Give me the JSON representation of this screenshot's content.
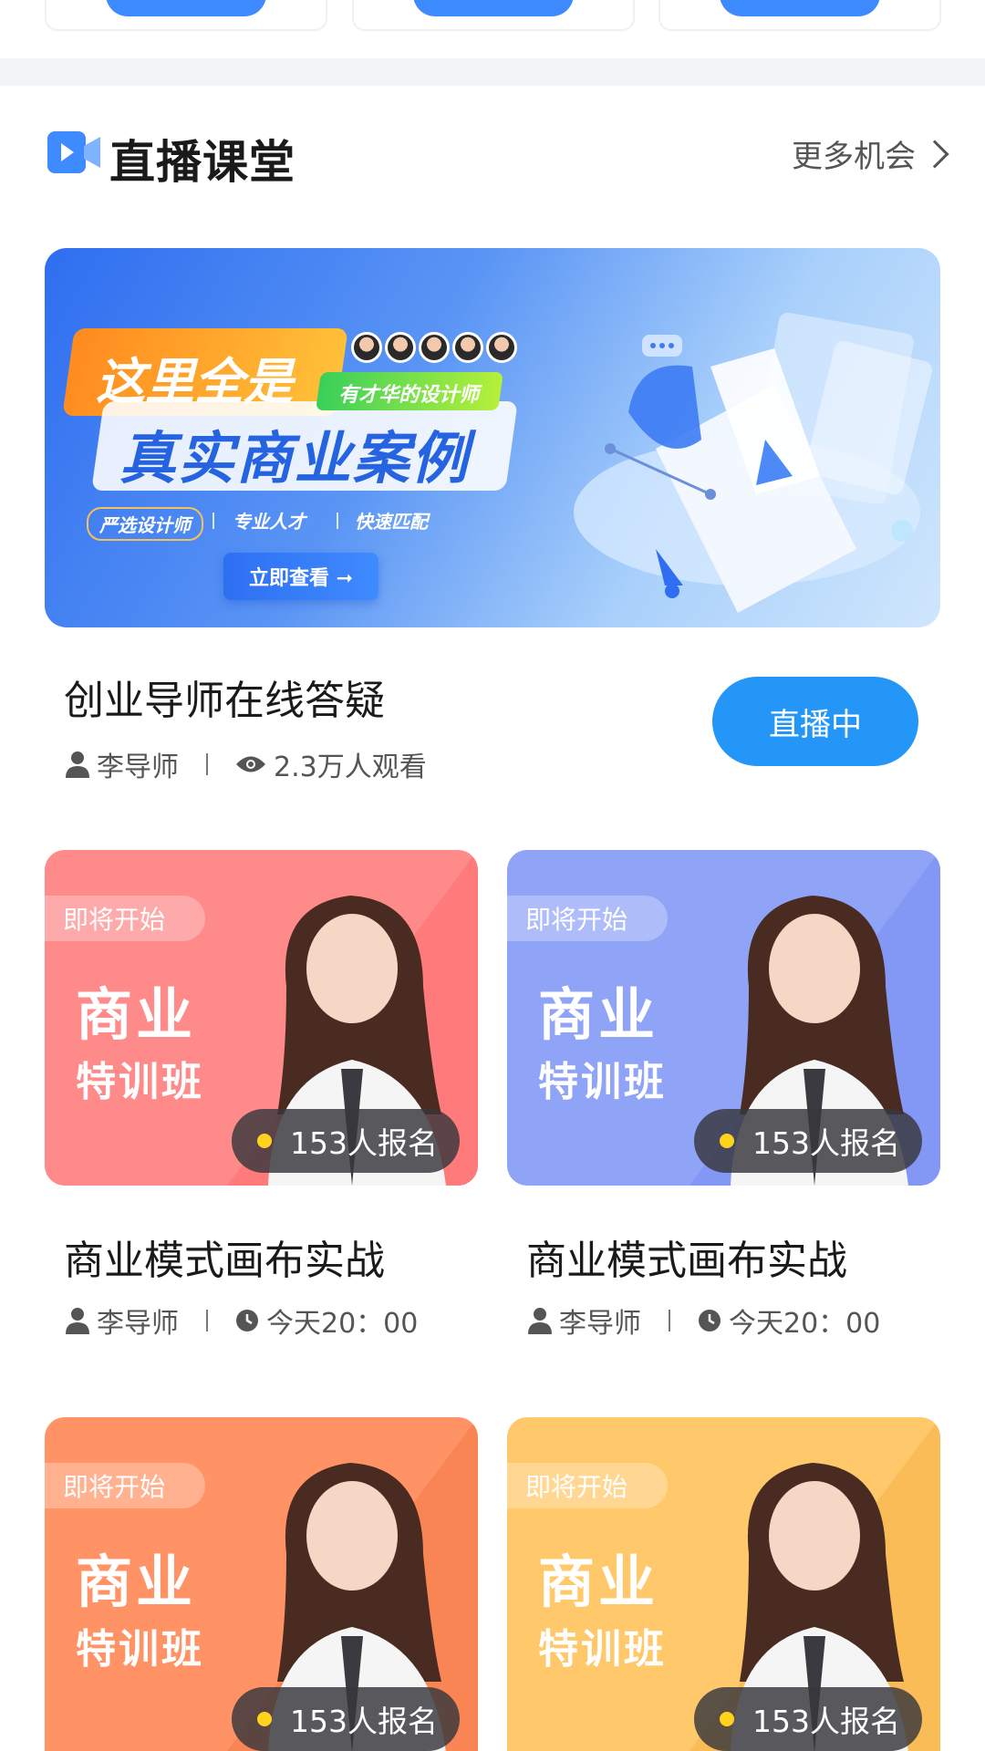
{
  "section": {
    "title": "直播课堂",
    "more_label": "更多机会"
  },
  "banner": {
    "headline_1": "这里全是",
    "headline_tag": "有才华的设计师",
    "headline_2": "真实商业案例",
    "features": [
      "严选设计师",
      "专业人才",
      "快速匹配"
    ],
    "cta_label": "立即查看 ➞"
  },
  "live": {
    "title": "创业导师在线答疑",
    "teacher": "李导师",
    "views": "2.3万人观看",
    "status_button": "直播中"
  },
  "courses": [
    {
      "badge": "即将开始",
      "big1": "商业",
      "big2": "特训班",
      "signups": "153人报名",
      "title": "商业模式画布实战",
      "teacher": "李导师",
      "time": "今天20：00",
      "color": "#ff8a8a"
    },
    {
      "badge": "即将开始",
      "big1": "商业",
      "big2": "特训班",
      "signups": "153人报名",
      "title": "商业模式画布实战",
      "teacher": "李导师",
      "time": "今天20：00",
      "color": "#8fa3f7"
    },
    {
      "badge": "即将开始",
      "big1": "商业",
      "big2": "特训班",
      "signups": "153人报名",
      "color": "#ff9366"
    },
    {
      "badge": "即将开始",
      "big1": "商业",
      "big2": "特训班",
      "signups": "153人报名",
      "color": "#ffc86a"
    }
  ],
  "colors": {
    "accent": "#2496f7",
    "brand_blue": "#3d8bff"
  }
}
